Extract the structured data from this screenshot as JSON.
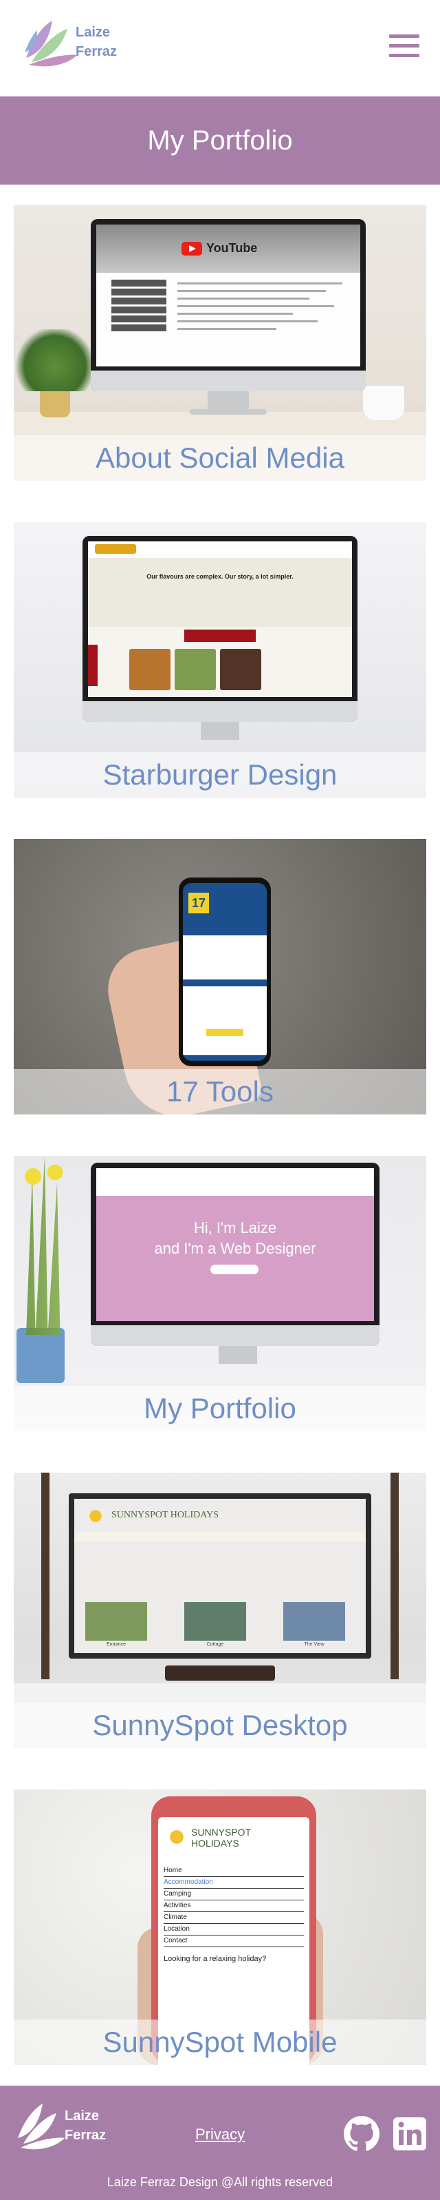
{
  "header": {
    "logo_line1": "Laize",
    "logo_line2": "Ferraz",
    "menu_icon": "hamburger-icon"
  },
  "banner": {
    "title": "My Portfolio"
  },
  "cards": [
    {
      "caption": "About Social Media",
      "screen_brand": "YouTube"
    },
    {
      "caption": "Starburger Design",
      "screen_heading": "Our flavours are complex. Our story, a lot simpler."
    },
    {
      "caption": "17 Tools",
      "screen_brand": "17"
    },
    {
      "caption": "My Portfolio",
      "screen_hero_line1": "Hi, I'm Laize",
      "screen_hero_line2": "and I'm a Web Designer"
    },
    {
      "caption": "SunnySpot Desktop",
      "screen_brand": "SUNNYSPOT HOLIDAYS",
      "screen_thumbs": [
        "Entrance",
        "Cottage",
        "The View"
      ]
    },
    {
      "caption": "SunnySpot Mobile",
      "screen_brand": "SUNNYSPOT HOLIDAYS",
      "screen_menu": [
        "Home",
        "Accommodation",
        "Camping",
        "Activities",
        "Climate",
        "Location",
        "Contact"
      ],
      "screen_question": "Looking for a relaxing holiday?"
    }
  ],
  "footer": {
    "logo_line1": "Laize",
    "logo_line2": "Ferraz",
    "privacy_label": "Privacy",
    "icons": [
      "github-icon",
      "linkedin-icon"
    ],
    "copyright": "Laize Ferraz Design @All rights reserved"
  },
  "colors": {
    "brand_purple": "#a77ea8",
    "caption_blue": "#6e8ec5",
    "logo_blue": "#7a8fc2"
  }
}
